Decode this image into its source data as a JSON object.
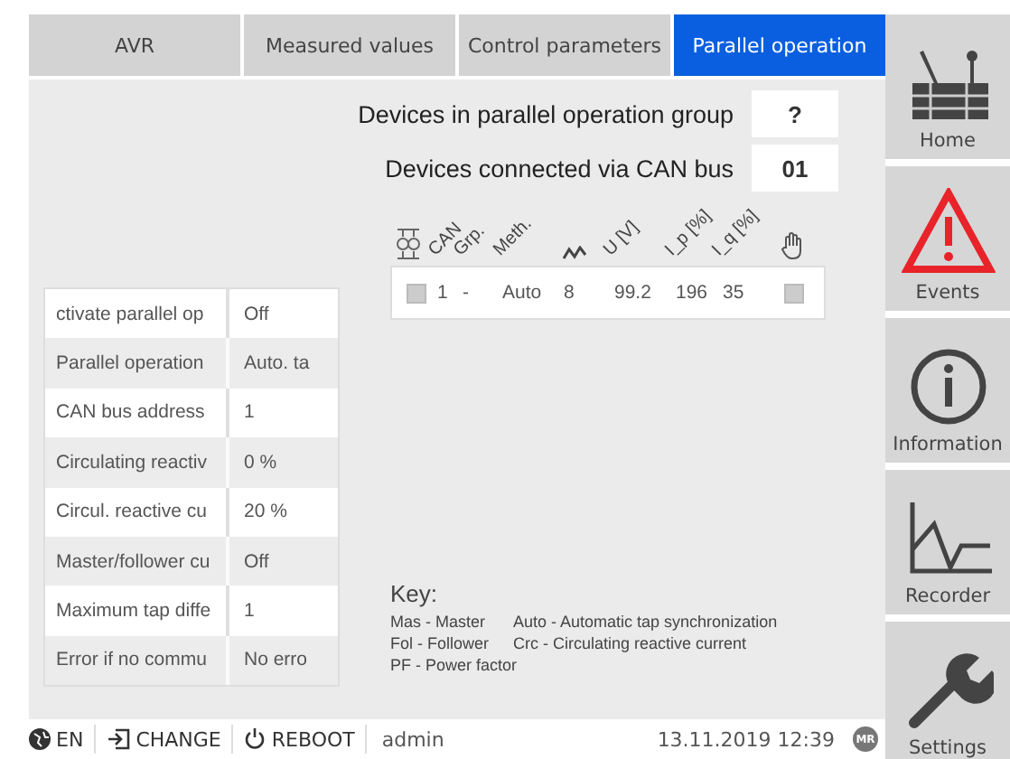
{
  "tabs": [
    {
      "label": "AVR",
      "selected": false
    },
    {
      "label": "Measured values",
      "selected": false
    },
    {
      "label": "Control parameters",
      "selected": false
    },
    {
      "label": "Parallel operation",
      "selected": true
    }
  ],
  "summary": [
    {
      "label": "Devices in parallel operation group",
      "value": "?"
    },
    {
      "label": "Devices connected via CAN bus",
      "value": "01"
    }
  ],
  "parameters": [
    {
      "label": "ctivate parallel op",
      "value": "Off"
    },
    {
      "label": "Parallel operation",
      "value": "Auto. ta"
    },
    {
      "label": "CAN bus address",
      "value": "1"
    },
    {
      "label": "Circulating reactiv",
      "value": "0 %"
    },
    {
      "label": "Circul. reactive cu",
      "value": "20 %"
    },
    {
      "label": "Master/follower cu",
      "value": "Off"
    },
    {
      "label": "Maximum tap diffe",
      "value": "1"
    },
    {
      "label": "Error if no commu",
      "value": "No erro"
    }
  ],
  "device_table": {
    "columns": [
      {
        "kind": "text",
        "label": "CAN"
      },
      {
        "kind": "text",
        "label": "Grp."
      },
      {
        "kind": "text",
        "label": "Meth."
      },
      {
        "kind": "wave"
      },
      {
        "kind": "text",
        "label": "U [V]"
      },
      {
        "kind": "text",
        "label": "I_p [%]"
      },
      {
        "kind": "text",
        "label": "I_q [%]"
      }
    ],
    "rows": [
      {
        "selected": false,
        "cells": [
          "1",
          "-",
          "Auto",
          "8",
          "99.2",
          "196",
          "35"
        ],
        "manual": false
      }
    ]
  },
  "key": {
    "title": "Key:",
    "entries": [
      [
        "Mas - Master",
        "Auto - Automatic tap synchronization"
      ],
      [
        "Fol - Follower",
        "Crc - Circulating reactive current"
      ],
      [
        "PF - Power factor"
      ]
    ]
  },
  "status_bar": {
    "language": "EN",
    "change": "CHANGE",
    "reboot": "REBOOT",
    "user": "admin",
    "datetime": "13.11.2019 12:39",
    "badge": "MR"
  },
  "sidebar": [
    {
      "kind": "home",
      "label": "Home"
    },
    {
      "kind": "events",
      "label": "Events"
    },
    {
      "kind": "information",
      "label": "Information"
    },
    {
      "kind": "recorder",
      "label": "Recorder"
    },
    {
      "kind": "settings",
      "label": "Settings"
    }
  ]
}
